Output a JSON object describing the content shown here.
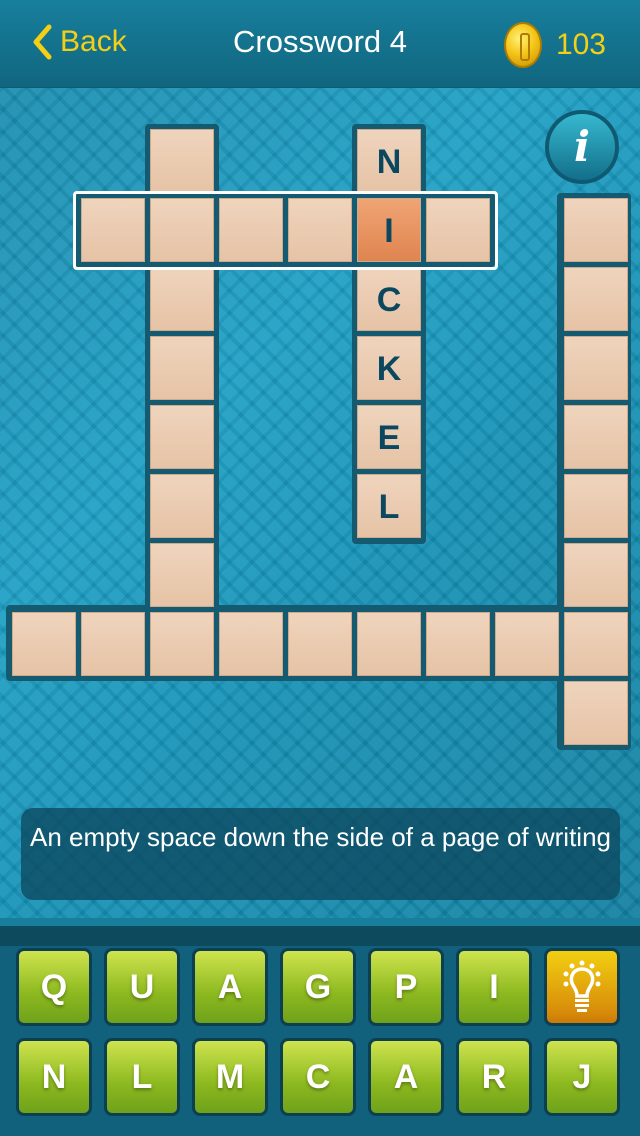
{
  "header": {
    "back_label": "Back",
    "title": "Crossword 4",
    "coins": "103"
  },
  "puzzle": {
    "selected_word": {
      "length": 6,
      "active_index": 4
    },
    "words": [
      {
        "direction": "across",
        "row": 1,
        "col": 1,
        "letters": [
          "",
          "",
          "",
          "",
          "I",
          ""
        ]
      },
      {
        "direction": "down",
        "row": 0,
        "col": 2,
        "letters": [
          "",
          "",
          "",
          "",
          "",
          "",
          "",
          ""
        ]
      },
      {
        "direction": "down",
        "row": 0,
        "col": 5,
        "letters": [
          "N",
          "I",
          "C",
          "K",
          "E",
          "L"
        ]
      },
      {
        "direction": "down",
        "row": 1,
        "col": 8,
        "letters": [
          "",
          "",
          "",
          "",
          "",
          "",
          "",
          ""
        ]
      },
      {
        "direction": "across",
        "row": 7,
        "col": 0,
        "letters": [
          "",
          "",
          "",
          "",
          "",
          "",
          "",
          "",
          ""
        ]
      }
    ]
  },
  "clue": "An empty space down the side of a page of writing",
  "keyboard": {
    "row1": [
      "Q",
      "U",
      "A",
      "G",
      "P",
      "I"
    ],
    "row2": [
      "N",
      "L",
      "M",
      "C",
      "A",
      "R",
      "J"
    ],
    "hint_icon": "lightbulb-icon"
  },
  "colors": {
    "accent": "#f3cf16",
    "active_cell": "#e89460",
    "key_green": "#8cb81f",
    "hint_orange": "#e0a00c"
  }
}
